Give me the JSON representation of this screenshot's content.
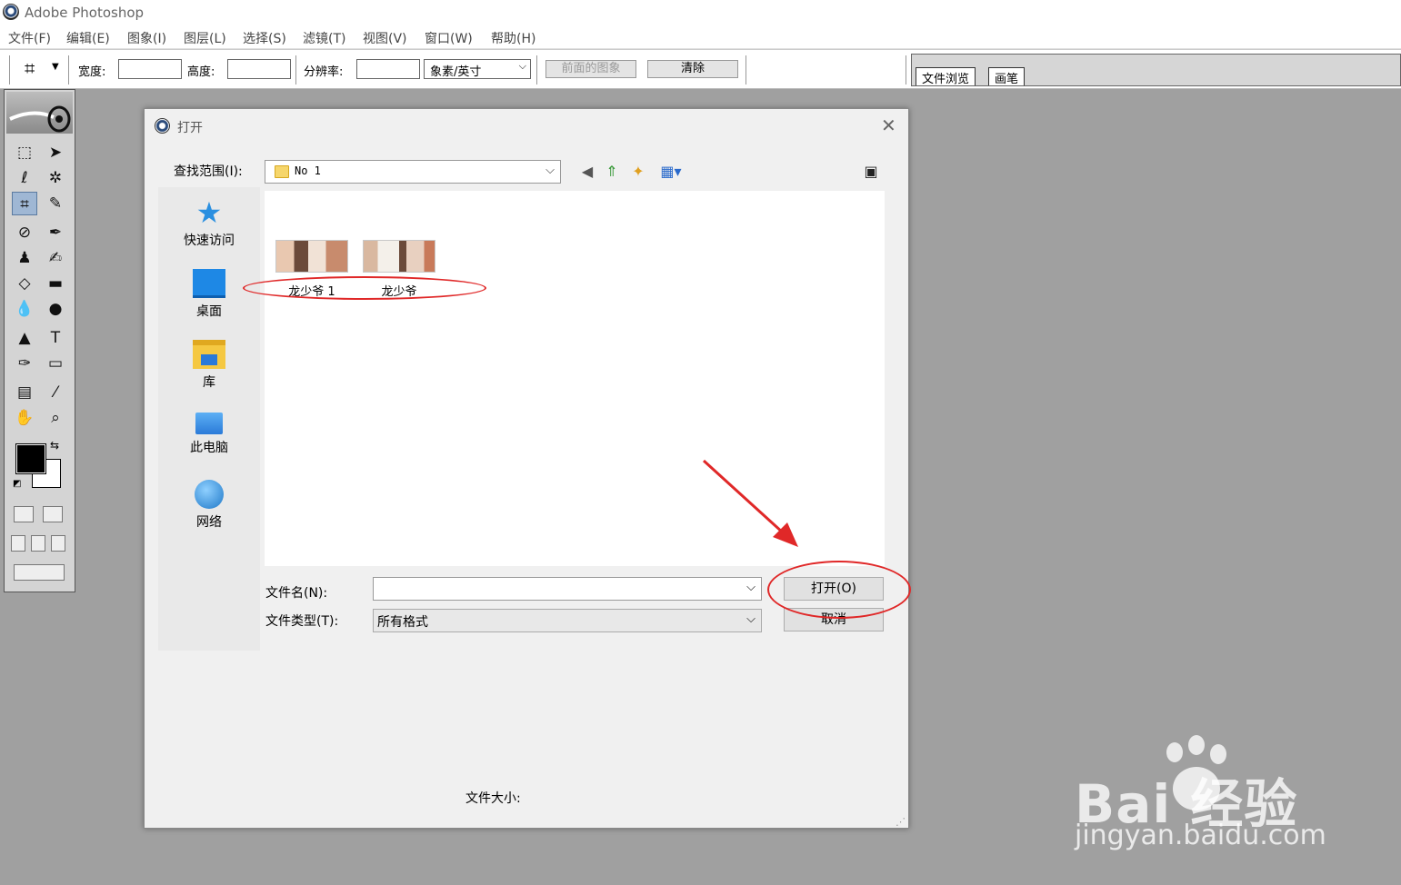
{
  "app": {
    "title": "Adobe Photoshop"
  },
  "menu": [
    {
      "label": "文件(F)",
      "name": "menu-file"
    },
    {
      "label": "编辑(E)",
      "name": "menu-edit"
    },
    {
      "label": "图象(I)",
      "name": "menu-image"
    },
    {
      "label": "图层(L)",
      "name": "menu-layer"
    },
    {
      "label": "选择(S)",
      "name": "menu-select"
    },
    {
      "label": "滤镜(T)",
      "name": "menu-filter"
    },
    {
      "label": "视图(V)",
      "name": "menu-view"
    },
    {
      "label": "窗口(W)",
      "name": "menu-window"
    },
    {
      "label": "帮助(H)",
      "name": "menu-help"
    }
  ],
  "options": {
    "width_label": "宽度:",
    "height_label": "高度:",
    "resolution_label": "分辨率:",
    "unit_value": "象素/英寸",
    "front_image_btn": "前面的图象",
    "clear_btn": "清除"
  },
  "palette_well": {
    "tabs": [
      "文件浏览",
      "画笔"
    ]
  },
  "dialog": {
    "title": "打开",
    "look_in_label": "查找范围(I):",
    "look_in_value": "No 1",
    "places": [
      "快速访问",
      "桌面",
      "库",
      "此电脑",
      "网络"
    ],
    "files": [
      "龙少爷 1",
      "龙少爷"
    ],
    "filename_label": "文件名(N):",
    "filename_value": "",
    "filetype_label": "文件类型(T):",
    "filetype_value": "所有格式",
    "open_btn": "打开(O)",
    "cancel_btn": "取消",
    "filesize_label": "文件大小:"
  },
  "watermark": {
    "brand": "Bai  经验",
    "url": "jingyan.baidu.com"
  },
  "colors": {
    "annotation": "#e02828",
    "workspace": "#a0a0a0",
    "dialog_bg": "#f0f0f0"
  }
}
